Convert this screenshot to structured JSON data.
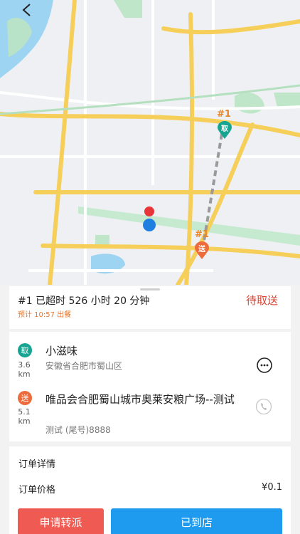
{
  "map": {
    "back_icon": "chevron-left-icon",
    "pickup_marker": {
      "label": "#1",
      "pin_text": "取",
      "color": "#17a592"
    },
    "dropoff_marker": {
      "label": "#1",
      "pin_text": "送",
      "color": "#ee6b3b"
    },
    "courier_marker_color": "#1e7fe0",
    "pickup_pin_color": "#e8353a"
  },
  "order": {
    "overdue_text": "#1 已超时 526 小时 20 分钟",
    "eta_text": "预计 10:57 出餐",
    "status": "待取送"
  },
  "route": {
    "pickup": {
      "badge": "取",
      "distance_value": "3.6",
      "distance_unit": "km",
      "name": "小滋味",
      "address": "安徽省合肥市蜀山区",
      "action_icon": "chat-icon"
    },
    "dropoff": {
      "badge": "送",
      "distance_value": "5.1",
      "distance_unit": "km",
      "name": "唯品会合肥蜀山城市奥莱安粮广场--测试",
      "contact": "测试 (尾号)8888",
      "action_icon": "phone-icon"
    }
  },
  "detail": {
    "title": "订单详情",
    "price_label": "订单价格",
    "price_value": "¥0.1"
  },
  "actions": {
    "transfer_label": "申请转派",
    "arrive_label": "已到店"
  },
  "colors": {
    "accent_red": "#e0402e",
    "accent_blue": "#1e9bef",
    "pickup_green": "#17a592",
    "dropoff_orange": "#ee6b3b"
  }
}
